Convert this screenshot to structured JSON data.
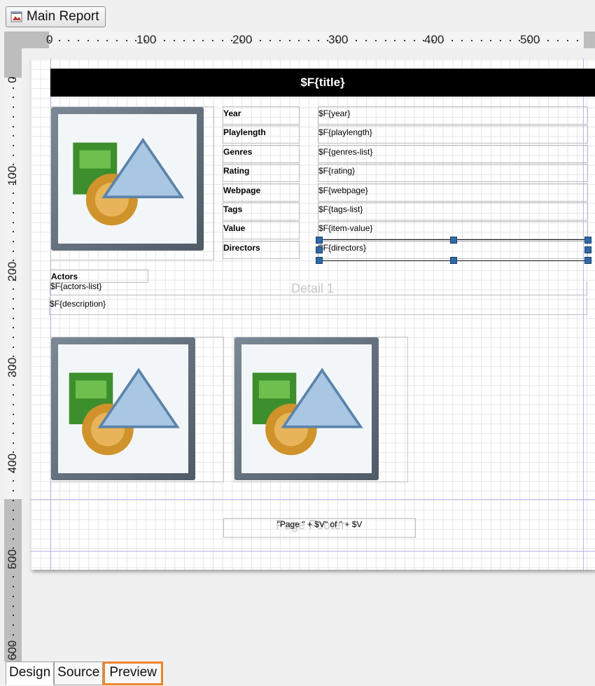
{
  "toolbar": {
    "main_report_label": "Main Report"
  },
  "rulers": {
    "horizontal": [
      "0",
      "100",
      "200",
      "300",
      "400",
      "500"
    ],
    "vertical": [
      "0",
      "100",
      "200",
      "300",
      "400",
      "500",
      "600"
    ]
  },
  "report": {
    "title": "$F{title}",
    "fields": [
      {
        "label": "Year",
        "value": "$F{year}"
      },
      {
        "label": "Playlength",
        "value": "$F{playlength}"
      },
      {
        "label": "Genres",
        "value": "$F{genres-list}"
      },
      {
        "label": "Rating",
        "value": "$F{rating}"
      },
      {
        "label": "Webpage",
        "value": "$F{webpage}"
      },
      {
        "label": "Tags",
        "value": "$F{tags-list}"
      },
      {
        "label": "Value",
        "value": "$F{item-value}"
      },
      {
        "label": "Directors",
        "value": "$F{directors}"
      }
    ],
    "actors_label": "Actors",
    "actors_value": "$F{actors-list}",
    "description_value": "$F{description}",
    "detail_band_label": "Detail 1",
    "page_footer_label": "Page Footer",
    "page_footer_expr": "\"Page \" + $V\" of \" + $V"
  },
  "tabs": [
    {
      "label": "Design"
    },
    {
      "label": "Source"
    },
    {
      "label": "Preview"
    }
  ],
  "colors": {
    "highlight": "#f0842c",
    "selection_handle": "#2e6aa8"
  }
}
